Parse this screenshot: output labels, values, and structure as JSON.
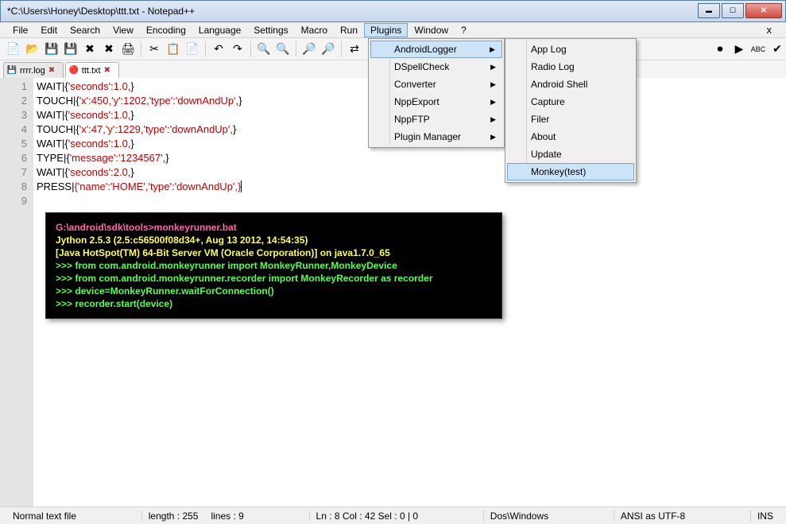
{
  "window": {
    "title": "*C:\\Users\\Honey\\Desktop\\ttt.txt - Notepad++"
  },
  "menubar": {
    "items": [
      "File",
      "Edit",
      "Search",
      "View",
      "Encoding",
      "Language",
      "Settings",
      "Macro",
      "Run",
      "Plugins",
      "Window",
      "?"
    ],
    "open_index": 9
  },
  "plugins_menu": {
    "items": [
      {
        "label": "AndroidLogger",
        "sub": true,
        "hover": true
      },
      {
        "label": "DSpellCheck",
        "sub": true
      },
      {
        "label": "Converter",
        "sub": true
      },
      {
        "label": "NppExport",
        "sub": true
      },
      {
        "label": "NppFTP",
        "sub": true
      },
      {
        "label": "Plugin Manager",
        "sub": true
      }
    ]
  },
  "androidlogger_menu": {
    "items": [
      {
        "label": "App Log"
      },
      {
        "label": "Radio Log"
      },
      {
        "label": "Android Shell"
      },
      {
        "label": "Capture"
      },
      {
        "label": "Filer"
      },
      {
        "label": "About"
      },
      {
        "label": "Update"
      },
      {
        "label": "Monkey(test)",
        "hover": true
      }
    ]
  },
  "tabs": [
    {
      "label": "rrrr.log",
      "active": false,
      "modified": false
    },
    {
      "label": "ttt.txt",
      "active": true,
      "modified": true
    }
  ],
  "editor": {
    "lines": [
      {
        "n": 1,
        "pre": "WAIT|{",
        "red": "'seconds':1.0,",
        "post": "}"
      },
      {
        "n": 2,
        "pre": "TOUCH|{",
        "red": "'x':450,'y':1202,'type':'downAndUp',",
        "post": "}"
      },
      {
        "n": 3,
        "pre": "WAIT|{",
        "red": "'seconds':1.0,",
        "post": "}"
      },
      {
        "n": 4,
        "pre": "TOUCH|{",
        "red": "'x':47,'y':1229,'type':'downAndUp',",
        "post": "}"
      },
      {
        "n": 5,
        "pre": "WAIT|{",
        "red": "'seconds':1.0,",
        "post": "}"
      },
      {
        "n": 6,
        "pre": "TYPE|{",
        "red": "'message':'1234567',",
        "post": "}"
      },
      {
        "n": 7,
        "pre": "WAIT|{",
        "red": "'seconds':2.0,",
        "post": "}"
      },
      {
        "n": 8,
        "pre": "PRESS|",
        "red": "{'name':'HOME','type':'downAndUp',}",
        "post": "",
        "cursor": true
      },
      {
        "n": 9,
        "pre": "",
        "red": "",
        "post": ""
      }
    ]
  },
  "console": {
    "lines": [
      {
        "cls": "c-pink",
        "text": "G:\\android\\sdk\\tools>monkeyrunner.bat"
      },
      {
        "cls": "c-yel",
        "text": "Jython 2.5.3 (2.5:c56500f08d34+, Aug 13 2012, 14:54:35)"
      },
      {
        "cls": "c-yel",
        "text": "[Java HotSpot(TM) 64-Bit Server VM (Oracle Corporation)] on java1.7.0_65"
      },
      {
        "cls": "c-grn",
        "text": ">>> from com.android.monkeyrunner import MonkeyRunner,MonkeyDevice"
      },
      {
        "cls": "c-grn",
        "text": ">>> from com.android.monkeyrunner.recorder import MonkeyRecorder as recorder"
      },
      {
        "cls": "c-grn",
        "text": ">>> device=MonkeyRunner.waitForConnection()"
      },
      {
        "cls": "c-grn",
        "text": ">>> recorder.start(device)"
      }
    ]
  },
  "status": {
    "filetype": "Normal text file",
    "length_label": "length : 255",
    "lines_label": "lines : 9",
    "pos": "Ln : 8    Col : 42    Sel : 0 | 0",
    "eol": "Dos\\Windows",
    "enc": "ANSI as UTF-8",
    "mode": "INS"
  },
  "toolbar_icons": [
    "new",
    "open",
    "save",
    "save-all",
    "close",
    "close-all",
    "print",
    "cut",
    "copy",
    "paste",
    "undo",
    "redo",
    "find",
    "replace",
    "zoom-in",
    "zoom-out",
    "sync",
    "wrap",
    "all-chars",
    "indent",
    "fold",
    "unfold",
    "hide",
    "rec",
    "play",
    "abc",
    "done"
  ]
}
